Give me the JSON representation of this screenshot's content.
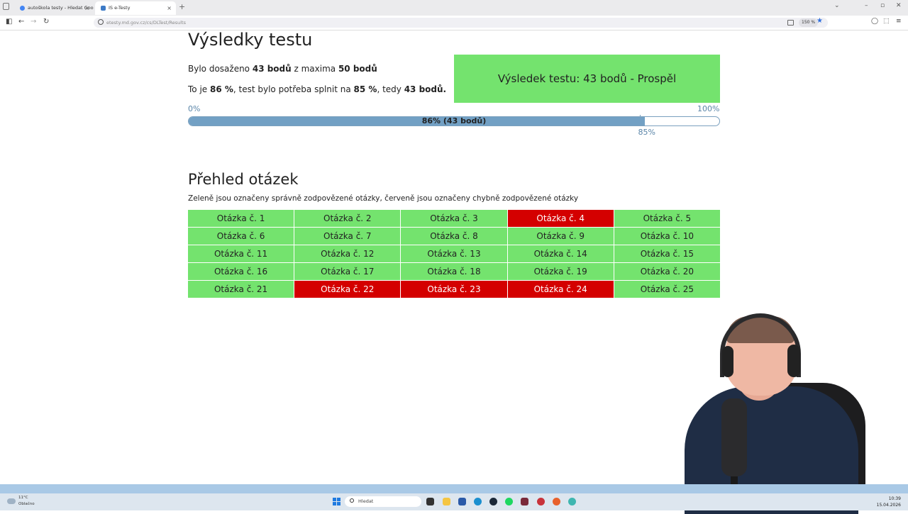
{
  "browser": {
    "tabs": [
      {
        "label": "autoškola testy - Hledat Goo",
        "active": false
      },
      {
        "label": "IS e-Testy",
        "active": true
      }
    ],
    "new_tab_symbol": "+",
    "close_symbol": "×",
    "url": "etesty.md.gov.cz/cs/DLTest/Results",
    "zoom": "150 %"
  },
  "page": {
    "title": "Výsledky testu",
    "summary1": {
      "pre": "Bylo dosaženo ",
      "score": "43 bodů",
      "mid": " z maxima ",
      "max": "50 bodů"
    },
    "summary2": {
      "pre": "To je ",
      "percent": "86 %",
      "mid": ", test bylo potřeba splnit na ",
      "required": "85 %",
      "mid2": ", tedy ",
      "required_points": "43 bodů."
    },
    "result_box": "Výsledek testu: 43 bodů - Prospěl",
    "result_color": "#74e36e",
    "progress": {
      "start_label": "0%",
      "end_label": "100%",
      "bar_label": "86% (43 bodů)",
      "value": 0.86,
      "threshold": 0.85,
      "threshold_label": "85%"
    },
    "overview_title": "Přehled otázek",
    "overview_desc": "Zeleně jsou označeny správně zodpovězené otázky, červeně jsou označeny chybně zodpovězené otázky",
    "colors": {
      "correct": "#74e36e",
      "wrong": "#d40000"
    },
    "questions": [
      {
        "label": "Otázka č. 1",
        "correct": true
      },
      {
        "label": "Otázka č. 2",
        "correct": true
      },
      {
        "label": "Otázka č. 3",
        "correct": true
      },
      {
        "label": "Otázka č. 4",
        "correct": false
      },
      {
        "label": "Otázka č. 5",
        "correct": true
      },
      {
        "label": "Otázka č. 6",
        "correct": true
      },
      {
        "label": "Otázka č. 7",
        "correct": true
      },
      {
        "label": "Otázka č. 8",
        "correct": true
      },
      {
        "label": "Otázka č. 9",
        "correct": true
      },
      {
        "label": "Otázka č. 10",
        "correct": true
      },
      {
        "label": "Otázka č. 11",
        "correct": true
      },
      {
        "label": "Otázka č. 12",
        "correct": true
      },
      {
        "label": "Otázka č. 13",
        "correct": true
      },
      {
        "label": "Otázka č. 14",
        "correct": true
      },
      {
        "label": "Otázka č. 15",
        "correct": true
      },
      {
        "label": "Otázka č. 16",
        "correct": true
      },
      {
        "label": "Otázka č. 17",
        "correct": true
      },
      {
        "label": "Otázka č. 18",
        "correct": true
      },
      {
        "label": "Otázka č. 19",
        "correct": true
      },
      {
        "label": "Otázka č. 20",
        "correct": true
      },
      {
        "label": "Otázka č. 21",
        "correct": true
      },
      {
        "label": "Otázka č. 22",
        "correct": false
      },
      {
        "label": "Otázka č. 23",
        "correct": false
      },
      {
        "label": "Otázka č. 24",
        "correct": false
      },
      {
        "label": "Otázka č. 25",
        "correct": true
      }
    ]
  },
  "taskbar": {
    "weather_temp": "11°C",
    "weather_desc": "Oblačno",
    "search_placeholder": "Hledat",
    "time": "10:39",
    "date": "15.04.2026"
  }
}
